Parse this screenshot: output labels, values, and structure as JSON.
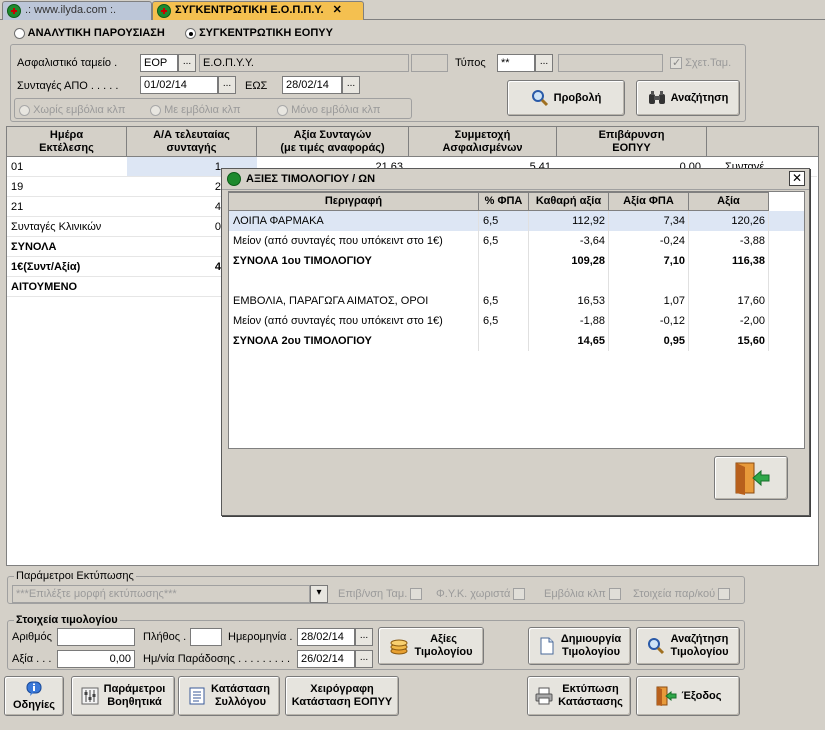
{
  "tabs": [
    {
      "label": ".: www.ilyda.com :."
    },
    {
      "label": "ΣΥΓΚΕΝΤΡΩΤΙΚΗ Ε.Ο.Π.Π.Υ."
    }
  ],
  "view_mode": {
    "options": [
      "ΑΝΑΛΥΤΙΚΗ ΠΑΡΟΥΣΙΑΣΗ",
      "ΣΥΓΚΕΝΤΡΩΤΙΚΗ ΕΟΠΥΥ"
    ],
    "selected": "ΣΥΓΚΕΝΤΡΩΤΙΚΗ ΕΟΠΥΥ"
  },
  "filters": {
    "fund_label": "Ασφαλιστικό ταμείο .",
    "fund_code": "ΕΟΡ",
    "fund_name": "Ε.Ο.Π.Υ.Υ.",
    "type_label": "Τύπος",
    "type_value": "**",
    "related_funds_label": "Σχετ.Ταμ.",
    "prescriptions_from_label": "Συνταγές ΑΠΟ . . . . .",
    "date_from": "01/02/14",
    "until_label": "ΕΩΣ",
    "date_to": "28/02/14",
    "vaccine_options": [
      "Χωρίς εμβόλια κλπ",
      "Με εμβόλια κλπ",
      "Μόνο εμβόλια κλπ"
    ]
  },
  "actions": {
    "view": "Προβολή",
    "search": "Αναζήτηση"
  },
  "grid": {
    "headers": [
      "Ημέρα\nΕκτέλεσης",
      "Α/Α τελευταίας\nσυνταγής",
      "Αξία Συνταγών\n(με τιμές αναφοράς)",
      "Συμμετοχή\nΑσφαλισμένων",
      "Επιβάρυνση\nΕΟΠΥΥ"
    ],
    "rows": [
      {
        "day": "01",
        "last": "1",
        "value": "21,63",
        "participation": "5,41",
        "charge": "0,00",
        "extra": "Συνταγέ"
      },
      {
        "day": "19",
        "last": "2",
        "value": "",
        "participation": "",
        "charge": "",
        "extra": ""
      },
      {
        "day": "21",
        "last": "4",
        "value": "",
        "participation": "",
        "charge": "",
        "extra": ""
      },
      {
        "day": "Συνταγές Κλινικών",
        "last": "0",
        "value": "",
        "participation": "",
        "charge": "",
        "extra": ""
      },
      {
        "day": "ΣΥΝΟΛΑ",
        "last": "",
        "value": "",
        "participation": "",
        "charge": "",
        "extra": ""
      },
      {
        "day": "1€(Συντ/Αξία)",
        "last": "4",
        "value": "",
        "participation": "",
        "charge": "",
        "extra": ""
      },
      {
        "day": "ΑΙΤΟΥΜΕΝΟ",
        "last": "",
        "value": "",
        "participation": "",
        "charge": "",
        "extra": ""
      }
    ]
  },
  "dialog": {
    "title": "ΑΞΙΕΣ ΤΙΜΟΛΟΓΙΟΥ / ΩΝ",
    "headers": [
      "Περιγραφή",
      "% ΦΠΑ",
      "Καθαρή αξία",
      "Αξία ΦΠΑ",
      "Αξία"
    ],
    "rows": [
      {
        "desc": "ΛΟΙΠΑ ΦΑΡΜΑΚΑ",
        "vat": "6,5",
        "net": "112,92",
        "vat_value": "7,34",
        "total": "120,26",
        "bold": false
      },
      {
        "desc": "Μείον (από συνταγές που υπόκειντ στο 1€)",
        "vat": "6,5",
        "net": "-3,64",
        "vat_value": "-0,24",
        "total": "-3,88",
        "bold": false
      },
      {
        "desc": "ΣΥΝΟΛΑ 1ου ΤΙΜΟΛΟΓΙΟΥ",
        "vat": "",
        "net": "109,28",
        "vat_value": "7,10",
        "total": "116,38",
        "bold": true
      },
      {
        "desc": "",
        "vat": "",
        "net": "",
        "vat_value": "",
        "total": "",
        "bold": false
      },
      {
        "desc": "ΕΜΒΟΛΙΑ, ΠΑΡΑΓΩΓΑ ΑΙΜΑΤΟΣ, ΟΡΟΙ",
        "vat": "6,5",
        "net": "16,53",
        "vat_value": "1,07",
        "total": "17,60",
        "bold": false
      },
      {
        "desc": "Μείον (από συνταγές που υπόκειντ στο 1€)",
        "vat": "6,5",
        "net": "-1,88",
        "vat_value": "-0,12",
        "total": "-2,00",
        "bold": false
      },
      {
        "desc": "ΣΥΝΟΛΑ 2ου ΤΙΜΟΛΟΓΙΟΥ",
        "vat": "",
        "net": "14,65",
        "vat_value": "0,95",
        "total": "15,60",
        "bold": true
      }
    ]
  },
  "print_params": {
    "legend": "Παράμετροι Εκτύπωσης",
    "format_placeholder": "***Επιλέξτε μορφή εκτύπωσης***",
    "checks": [
      "Επιβ/νση Ταμ.",
      "Φ.Υ.Κ. χωριστά",
      "Εμβόλια κλπ",
      "Στοιχεία παρ/κού"
    ]
  },
  "invoice": {
    "legend": "Στοιχεία τιμολογίου",
    "number_label": "Αριθμός",
    "number_value": "",
    "count_label": "Πλήθος .",
    "count_value": "",
    "date_label": "Ημερομηνία .",
    "date_value": "28/02/14",
    "value_label": "Αξία . . .",
    "value_value": "0,00",
    "delivery_label": "Ημ/νία Παράδοσης . . . . . . . . .",
    "delivery_value": "26/02/14",
    "values_button": "Αξίες\nΤιμολογίου",
    "create_button": "Δημιουργία\nΤιμολογίου",
    "search_button": "Αναζήτηση\nΤιμολογίου"
  },
  "bottom": {
    "instructions": "Οδηγίες",
    "aux_params": "Παράμετροι\nΒοηθητικά",
    "collection_status": "Κατάσταση\nΣυλλόγου",
    "manual_status": "Χειρόγραφη\nΚατάσταση ΕΟΠΥΥ",
    "print_status": "Εκτύπωση\nΚατάστασης",
    "exit": "Έξοδος"
  },
  "colors": {
    "active_tab": "#f4c050",
    "selected_row": "#dde6f4",
    "dialog_title_bar": "#d4d0c8"
  }
}
